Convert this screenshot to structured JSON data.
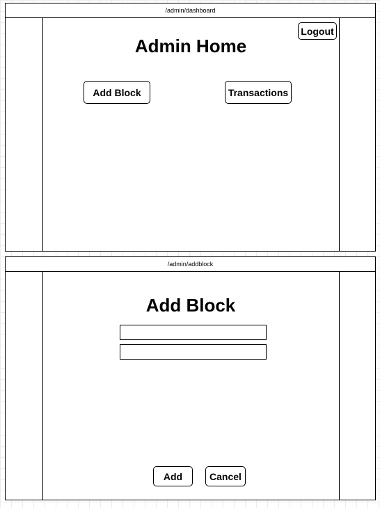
{
  "dashboard": {
    "url": "/admin/dashboard",
    "title": "Admin Home",
    "logout_label": "Logout",
    "add_block_label": "Add Block",
    "transactions_label": "Transactions"
  },
  "addblock": {
    "url": "/admin/addblock",
    "title": "Add Block",
    "field_1_value": "",
    "field_2_value": "",
    "add_label": "Add",
    "cancel_label": "Cancel"
  }
}
